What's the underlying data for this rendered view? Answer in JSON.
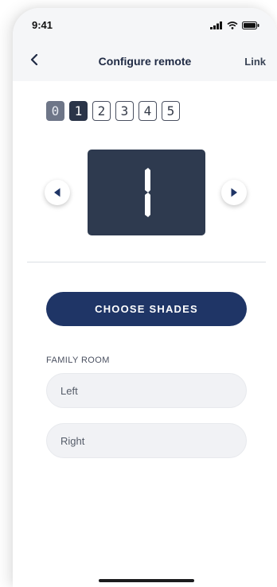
{
  "status_bar": {
    "time": "9:41"
  },
  "nav": {
    "back_icon": "chevron-left-icon",
    "title": "Configure remote",
    "right_link": "Link"
  },
  "channels": {
    "options": [
      "0",
      "1",
      "2",
      "3",
      "4",
      "5"
    ],
    "selected": "1"
  },
  "display": {
    "value": "1"
  },
  "actions": {
    "choose_shades": "CHOOSE SHADES"
  },
  "room": {
    "label": "FAMILY ROOM",
    "shades": [
      "Left",
      "Right"
    ]
  },
  "colors": {
    "primary": "#1f3566",
    "display_bg": "#2e3a4f",
    "nav_bg": "#f5f6f8"
  }
}
